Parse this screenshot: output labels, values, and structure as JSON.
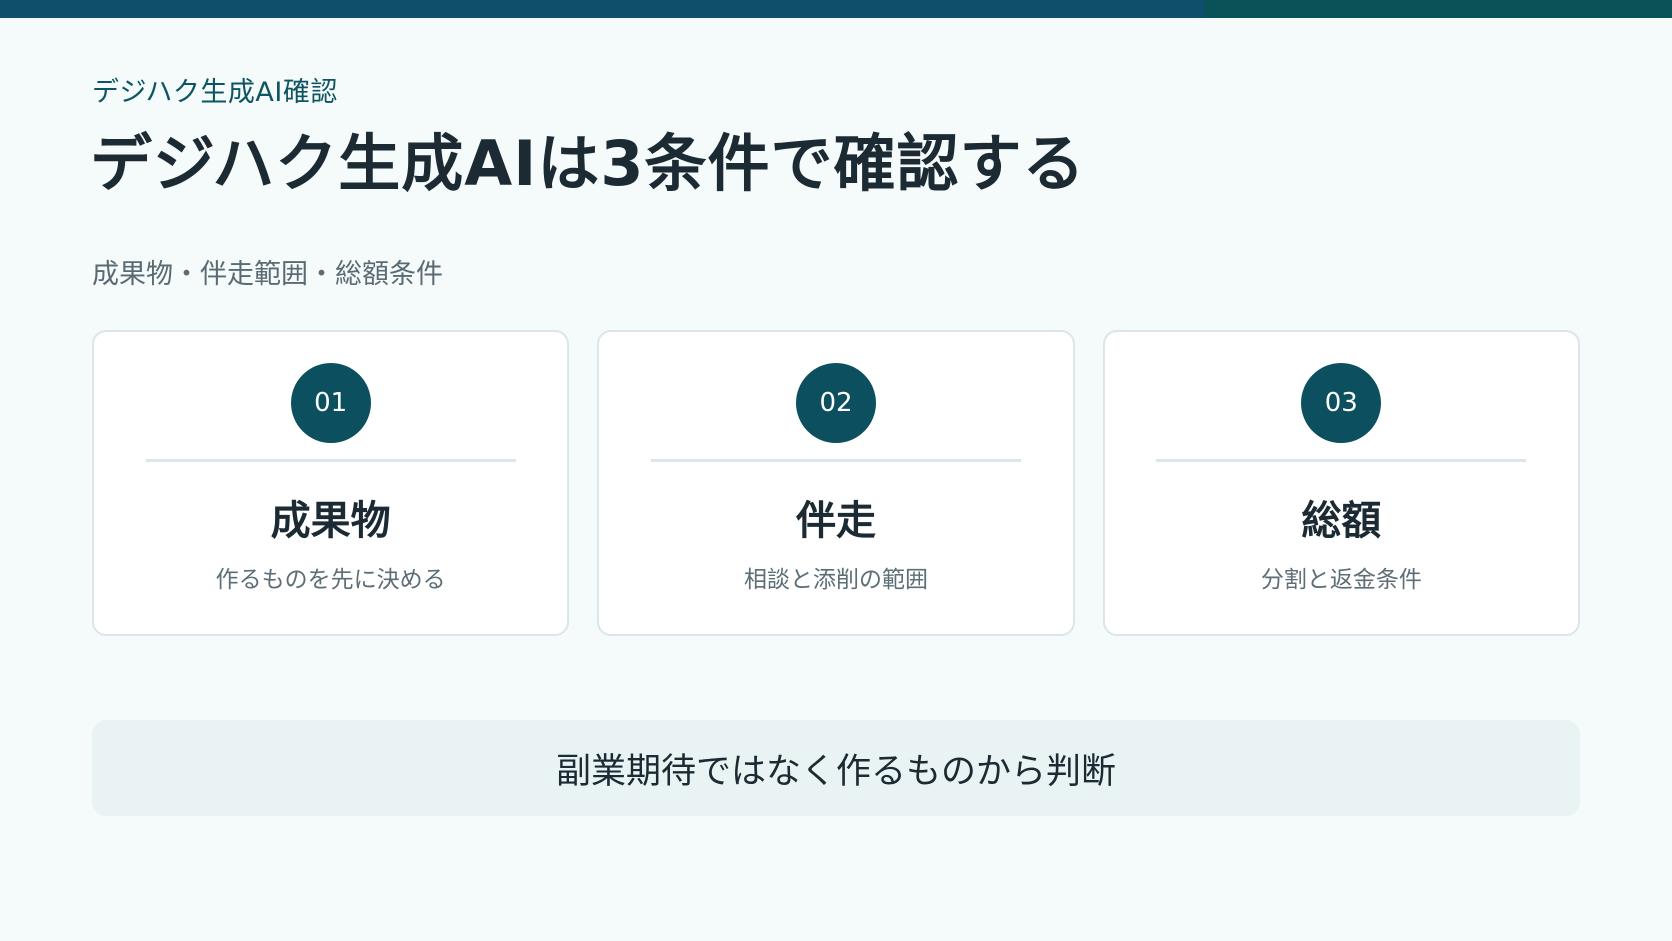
{
  "header": {
    "eyebrow": "デジハク生成AI確認",
    "title": "デジハク生成AIは3条件で確認する",
    "subtitle": "成果物・伴走範囲・総額条件"
  },
  "cards": [
    {
      "number": "01",
      "title": "成果物",
      "description": "作るものを先に決める"
    },
    {
      "number": "02",
      "title": "伴走",
      "description": "相談と添削の範囲"
    },
    {
      "number": "03",
      "title": "総額",
      "description": "分割と返金条件"
    }
  ],
  "footer": {
    "text": "副業期待ではなく作るものから判断"
  },
  "colors": {
    "accent": "#0c4f5e",
    "top_bar_primary": "#0f4f6b",
    "top_bar_secondary": "#0b5158",
    "background": "#f5fafa"
  }
}
